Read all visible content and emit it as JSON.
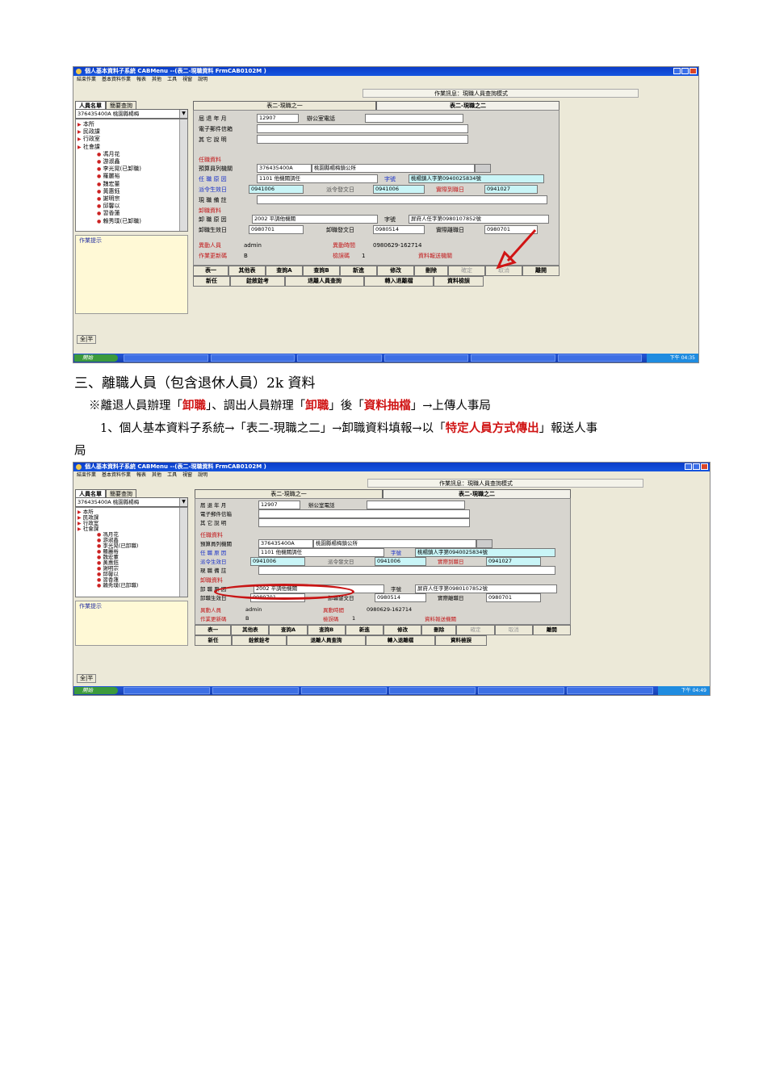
{
  "window": {
    "title": "個人基本資料子系統 CABMenu --(表二-現職資料 FrmCAB0102M )",
    "menu": [
      "結束作業",
      "基本資料作業",
      "報表",
      "其他",
      "工具",
      "視窗",
      "說明"
    ]
  },
  "status_message": "作業訊息：現職人員查詢模式",
  "left": {
    "tabs": [
      "人員名單",
      "簡要查詢"
    ],
    "org_select": "376435400A  桃園縣楊梅",
    "tree_top": [
      "本所",
      "民政課",
      "行政室",
      "社會課"
    ],
    "tree_people": [
      "馮月花",
      "游淑鑫",
      "李光晃(已卸職)",
      "羅麗裕",
      "魏宏董",
      "黃惠鈺",
      "謝明宗",
      "邱馨以",
      "習香蓮",
      "賴秀璞(已卸職)"
    ],
    "hint_label": "作業提示",
    "half_button": "全|半"
  },
  "tabs": [
    "表二-現職之一",
    "表二-現職之二"
  ],
  "form": {
    "retire_month_label": "屆 退 年 月",
    "retire_month": "12907",
    "office_phone_label": "辦公室電話",
    "email_label": "電子郵件信箱",
    "other_label": "其 它 說 明",
    "appoint_section": "任職資料",
    "budget_label": "預算員列機關",
    "budget_code": "376435400A",
    "budget_name": "桃園縣楊梅鎮公所",
    "appoint_reason_label": "任 職 原 因",
    "appoint_reason": "1101 他機關調任",
    "doc_no_label": "字號",
    "appoint_doc_no": "桃楊鎮人字第0940025834號",
    "effective_label": "派令生效日",
    "effective_date": "0941006",
    "issue_label": "派令發文日",
    "issue_date": "0941006",
    "arrive_label": "實際到職日",
    "arrive_date": "0941027",
    "note_label": "現 職 備 註",
    "leave_section": "卸職資料",
    "leave_reason_label": "卸 職 原 因",
    "leave_reason": "2002 平調他機關",
    "leave_doc_no": "屏府人任字第0980107852號",
    "leave_effective_label": "卸職生效日",
    "leave_effective": "0980701",
    "leave_issue_label": "卸職發文日",
    "leave_issue": "0980514",
    "leave_actual_label": "實際離職日",
    "leave_actual": "0980701",
    "changer_label": "異動人員",
    "changer": "admin",
    "change_time_label": "異動時間",
    "change_time": "0980629-162714",
    "update_code_label": "作業更新碼",
    "update_code": "B",
    "check_code_label": "檢誤碼",
    "check_code": "1",
    "send_label": "資料報送機關"
  },
  "buttons_row1": [
    "表一",
    "其他表",
    "查詢A",
    "查詢B",
    "新進",
    "修改",
    "刪除",
    "確定",
    "取消",
    "離開"
  ],
  "buttons_row2": [
    "新任",
    "銓敘銓考",
    "退離人員查詢",
    "轉入退離檔",
    "資料檢誤"
  ],
  "taskbar": {
    "start": "開始",
    "clock1": "下午 04:35",
    "clock2": "下午 04:49"
  },
  "doc": {
    "heading": "三、離職人員（包含退休人員）2k 資料",
    "line1_a": "※離退人員辦理「",
    "line1_b": "卸職",
    "line1_c": "」、調出人員辦理「",
    "line1_d": "卸職",
    "line1_e": "」後「",
    "line1_f": "資料抽檔",
    "line1_g": "」→上傳人事局",
    "line2_a": "1、個人基本資料子系統→「表二-現職之二」→卸職資料填報→以「",
    "line2_b": "特定人員方式傳出",
    "line2_c": "」報送人事",
    "line3": "局"
  }
}
